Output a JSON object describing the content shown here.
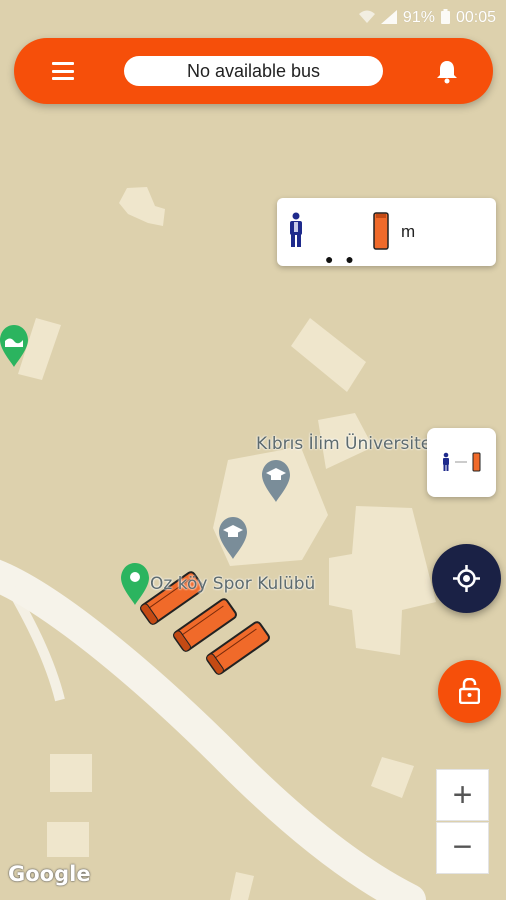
{
  "status_bar": {
    "battery": "91%",
    "time": "00:05"
  },
  "top_bar": {
    "status_text": "No available bus"
  },
  "distance_card": {
    "unit": "m",
    "loading": "● ●"
  },
  "map": {
    "labels": {
      "university": "Kıbrıs İlim Üniversite",
      "sports_club": "Oz  köy Spor Kulübü"
    },
    "attribution": "Google"
  },
  "zoom": {
    "in_label": "+",
    "out_label": "−"
  },
  "colors": {
    "accent": "#f64f0a",
    "map_land": "#ddd1ad",
    "locate_button": "#1a2145",
    "bus": "#f06a2a",
    "person": "#1e2a8c"
  },
  "icons": [
    "menu-icon",
    "bell-icon",
    "person-icon",
    "bus-icon",
    "crosshair-icon",
    "unlock-icon",
    "map-pin-icon"
  ]
}
